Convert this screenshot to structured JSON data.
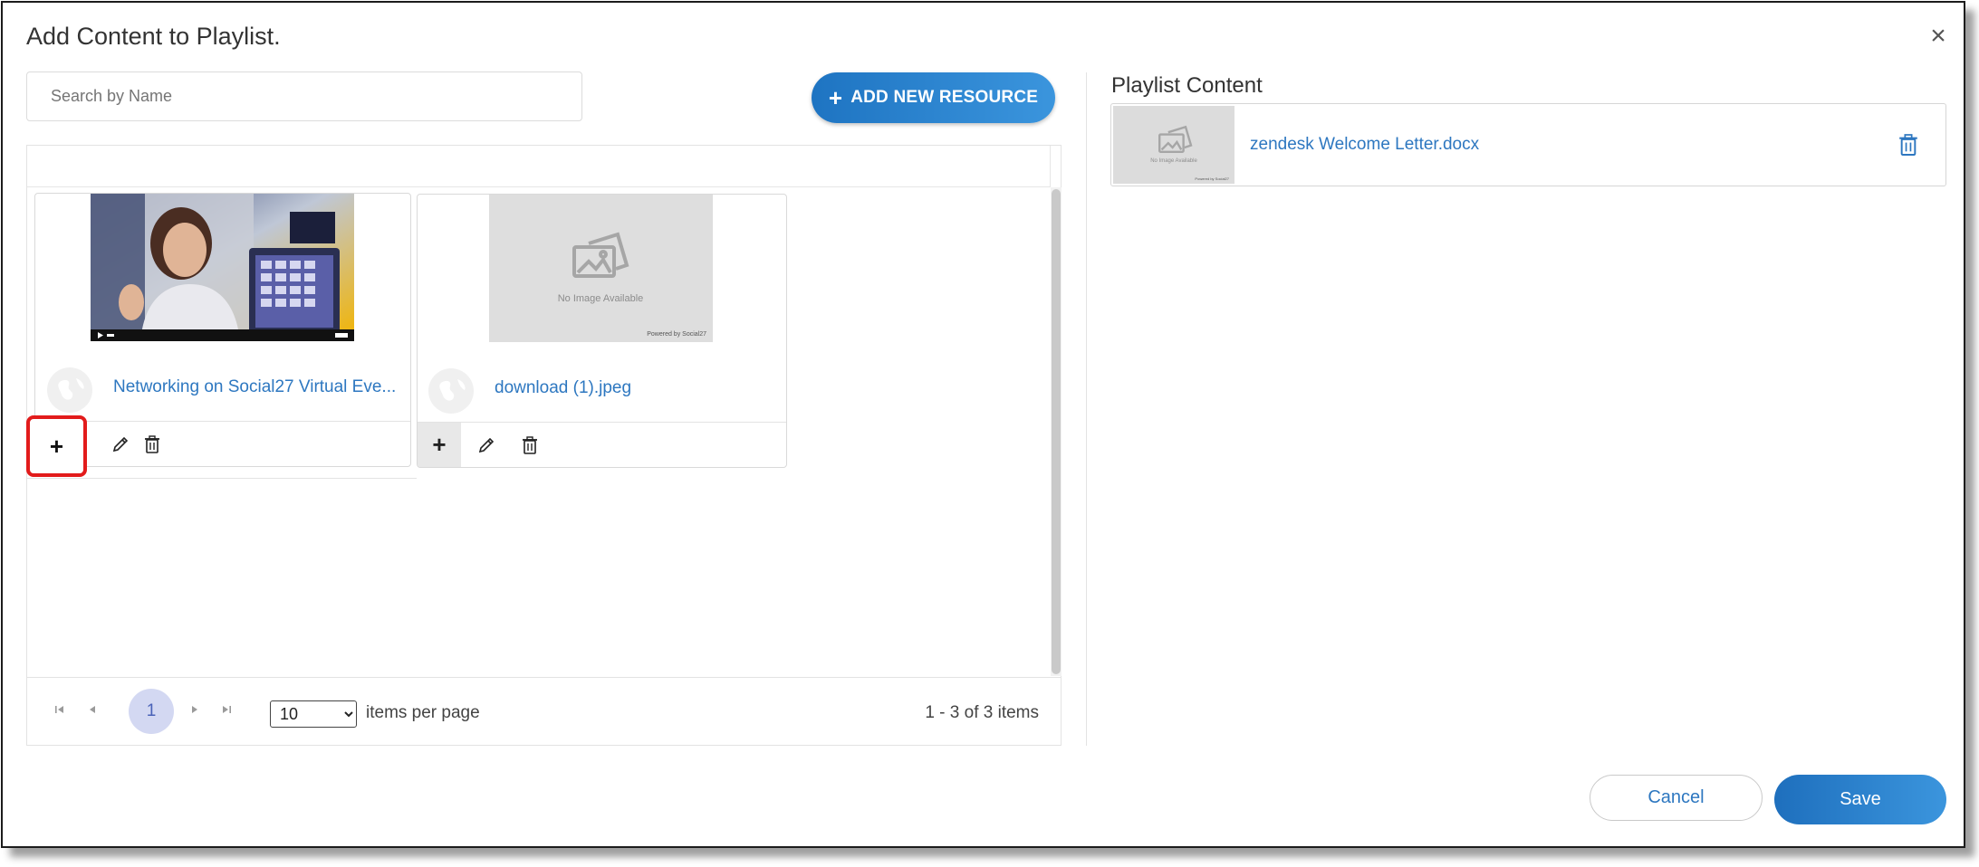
{
  "dialog": {
    "title": "Add Content to Playlist.",
    "close_icon": "×"
  },
  "search": {
    "placeholder": "Search by Name",
    "value": ""
  },
  "toolbar": {
    "add_resource_icon": "+",
    "add_resource_label": "ADD NEW RESOURCE"
  },
  "resources": [
    {
      "title": "Networking on Social27 Virtual Eve...",
      "thumbnail": "video-thumbnail-woman-waving",
      "add_label": "+"
    },
    {
      "title": "download (1).jpeg",
      "thumbnail": "no-image-placeholder",
      "placeholder_text": "No Image Available",
      "powered_text": "Powered by Social27",
      "add_label": "+"
    }
  ],
  "pager": {
    "current_page": "1",
    "per_page": "10",
    "per_page_options": [
      "10"
    ],
    "per_page_label": "items per page",
    "count_text": "1 - 3 of 3 items"
  },
  "playlist": {
    "heading": "Playlist Content",
    "items": [
      {
        "name": "zendesk Welcome Letter.docx",
        "thumbnail": "no-image-placeholder",
        "placeholder_text": "No Image Available",
        "powered_text": "Powered by Social27"
      }
    ]
  },
  "actions": {
    "cancel_label": "Cancel",
    "save_label": "Save"
  },
  "colors": {
    "accent": "#2d77c0",
    "button_gradient_start": "#1e74c2",
    "button_gradient_end": "#3b95dd",
    "highlight": "#e21b1b",
    "active_page": "#d3d8f2"
  }
}
